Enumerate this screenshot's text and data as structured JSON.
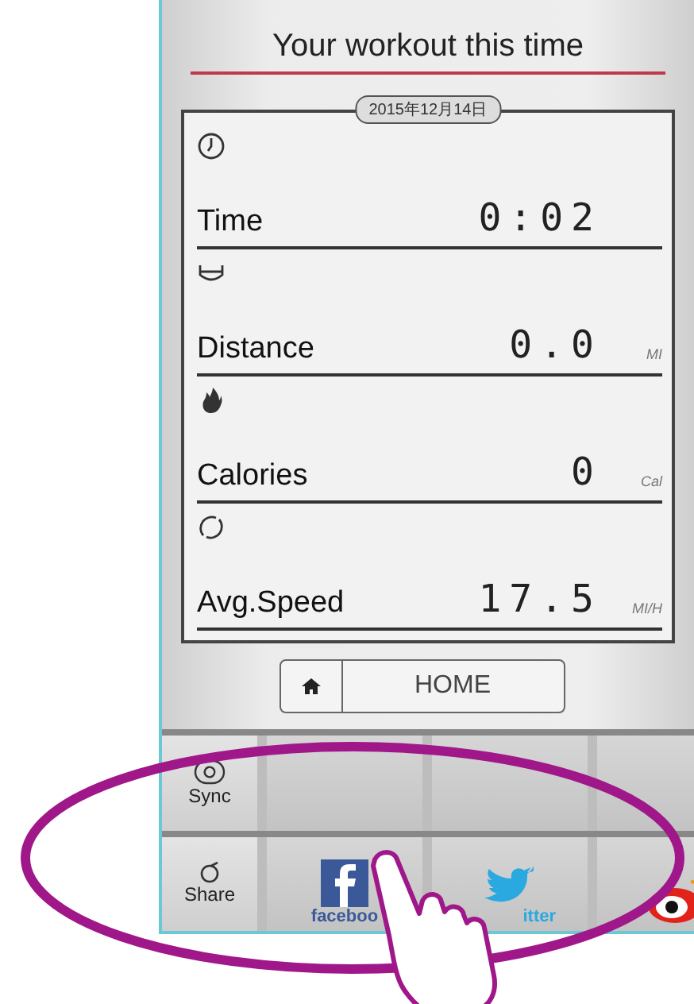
{
  "title": "Your workout this time",
  "date": "2015年12月14日",
  "stats": [
    {
      "kind": "time",
      "label": "Time",
      "value": "0:02"
    },
    {
      "kind": "distance",
      "label": "Distance",
      "value": "0.0",
      "unit": "MI"
    },
    {
      "kind": "calories",
      "label": "Calories",
      "value": "0",
      "unit": "Cal"
    },
    {
      "kind": "speed",
      "label": "Avg.Speed",
      "value": "17.5",
      "unit": "MI/H"
    }
  ],
  "home_button": {
    "label": "HOME"
  },
  "share_rows": [
    {
      "kind": "sync",
      "label": "Sync",
      "tiles": [
        {
          "kind": "empty"
        },
        {
          "kind": "empty"
        },
        {
          "kind": "empty"
        }
      ]
    },
    {
      "kind": "share",
      "label": "Share",
      "tiles": [
        {
          "kind": "facebook",
          "label": "faceboo"
        },
        {
          "kind": "twitter",
          "label": "itter"
        },
        {
          "kind": "red-logo"
        }
      ]
    }
  ]
}
